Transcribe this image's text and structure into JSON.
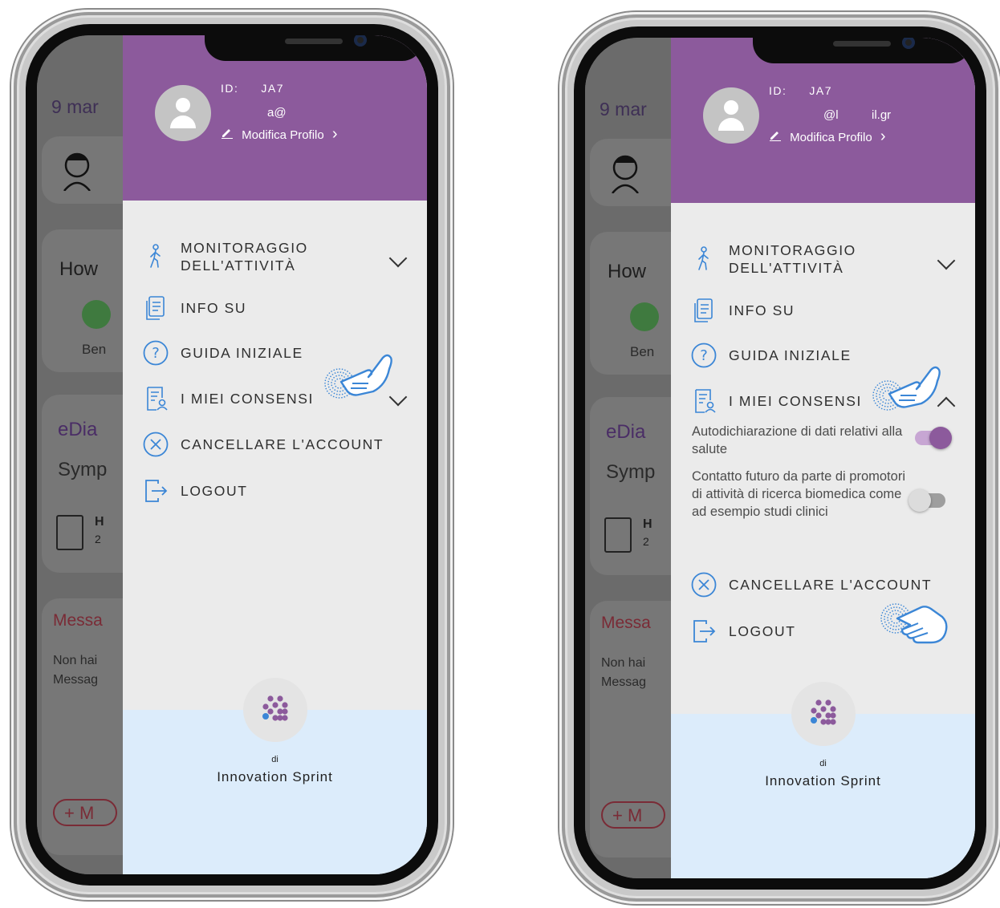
{
  "screens": [
    {
      "background_app": {
        "date": "9 mar",
        "card_how": "How",
        "mood_label": "Ben",
        "ediary": "eDia",
        "symp": "Symp",
        "entry_title": "H",
        "entry_sub": "2",
        "messages_title": "Messa",
        "messages_text_1": "Non hai",
        "messages_text_2": "Messag",
        "add_button": "+ M"
      },
      "profile": {
        "id_label": "ID:",
        "id_value": "JA7",
        "email": "a@",
        "edit_link": "Modifica Profilo",
        "edit_chevron": "›"
      },
      "menu": {
        "activity_1": "MONITORAGGIO",
        "activity_2": "DELL'ATTIVITÀ",
        "about": "INFO SU",
        "guide": "GUIDA INIZIALE",
        "consents": "I MIEI CONSENSI",
        "delete": "CANCELLARE L'ACCOUNT",
        "logout": "LOGOUT"
      },
      "footer": {
        "by": "di",
        "company": "Innovation Sprint"
      }
    },
    {
      "background_app": {
        "date": "9 mar",
        "card_how": "How",
        "mood_label": "Ben",
        "ediary": "eDia",
        "symp": "Symp",
        "entry_title": "H",
        "entry_sub": "2",
        "messages_title": "Messa",
        "messages_text_1": "Non hai",
        "messages_text_2": "Messag",
        "add_button": "+ M"
      },
      "profile": {
        "id_label": "ID:",
        "id_value": "JA7",
        "email_part_1": "@l",
        "email_part_2": "il.gr",
        "edit_link": "Modifica Profilo",
        "edit_chevron": "›"
      },
      "menu": {
        "activity_1": "MONITORAGGIO",
        "activity_2": "DELL'ATTIVITÀ",
        "about": "INFO SU",
        "guide": "GUIDA INIZIALE",
        "consents": "I MIEI CONSENSI",
        "delete": "CANCELLARE L'ACCOUNT",
        "logout": "LOGOUT"
      },
      "consents": [
        {
          "text": "Autodichiarazione di dati relativi alla salute",
          "enabled": true
        },
        {
          "text": "Contatto futuro da parte di promotori di attività di ricerca biomedica come ad esempio studi clinici",
          "enabled": false
        }
      ],
      "footer": {
        "by": "di",
        "company": "Innovation Sprint"
      }
    }
  ],
  "colors": {
    "accent_purple": "#8c5a9c",
    "icon_blue": "#3b86d6",
    "footer_bg": "#dcecfb",
    "drawer_bg": "#ebebeb"
  }
}
